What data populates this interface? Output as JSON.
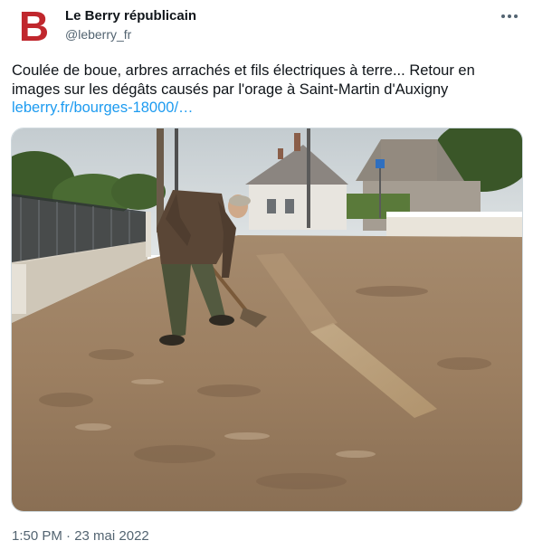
{
  "account": {
    "display_name": "Le Berry républicain",
    "handle": "@leberry_fr",
    "logo_letter": "B",
    "logo_color": "#c0272d"
  },
  "tweet": {
    "text": "Coulée de boue, arbres arrachés et fils électriques à terre... Retour en images sur les dégâts causés par l'orage à Saint-Martin d'Auxigny",
    "link_text": "leberry.fr/bourges-18000/…",
    "link_color": "#1d9bf0",
    "timestamp": "1:50 PM · 23 mai 2022"
  },
  "media": {
    "type": "photo"
  },
  "icons": {
    "more": "more-horizontal-icon",
    "road_sign": "road-sign-icon"
  }
}
